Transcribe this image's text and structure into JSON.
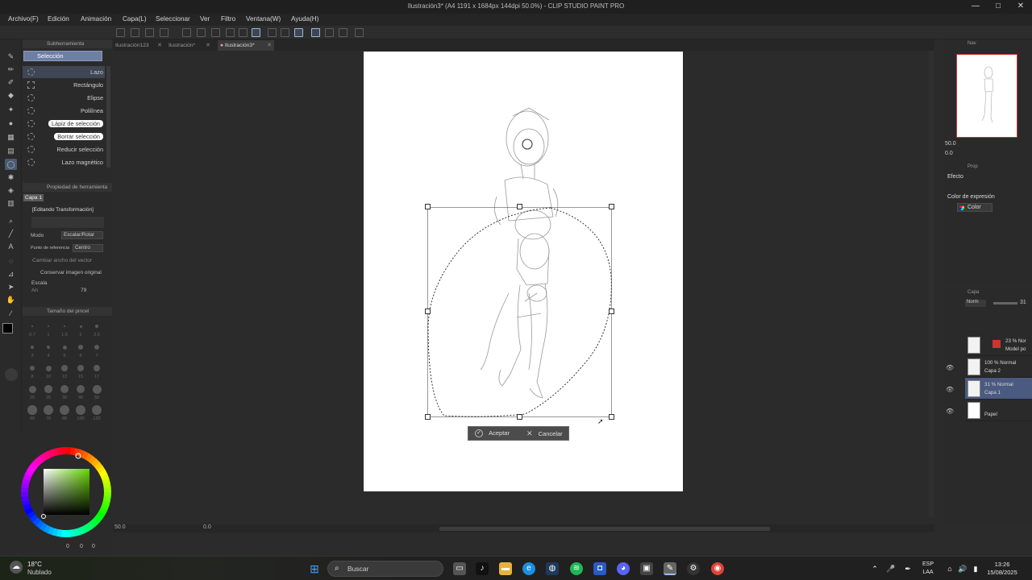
{
  "window": {
    "title": "Ilustración3* (A4 1191 x 1684px 144dpi 50.0%) - CLIP STUDIO PAINT PRO",
    "controls": [
      "—",
      "□",
      "✕"
    ]
  },
  "menu": [
    "Archivo(F)",
    "Edición",
    "Animación",
    "Capa(L)",
    "Seleccionar",
    "Ver",
    "Filtro",
    "Ventana(W)",
    "Ayuda(H)"
  ],
  "subtool": {
    "header": "Subherramienta",
    "active_tab": "Selección",
    "items": [
      "Lazo",
      "Rectángulo",
      "Elipse",
      "Polilínea",
      "Lápiz de selección",
      "Borrar selección",
      "Reducir selección",
      "Lazo magnético"
    ]
  },
  "tool_property": {
    "header": "Propiedad de herramienta",
    "layer_label": "Capa 1",
    "editing_label": "[Editando Transformación]",
    "mode_label": "Modo",
    "mode_value": "Escalar/Rotar",
    "ref_label": "Punto de referencia",
    "ref_value": "Centro",
    "vector_label": "Cambiar ancho del vector",
    "keep_label": "Conservar imagen original",
    "scale_label": "Escala",
    "scale_sub": "An",
    "scale_value": "79"
  },
  "brush_size": {
    "header": "Tamaño del pincel",
    "sizes": [
      "0.7",
      "1",
      "1.5",
      "2",
      "2.5",
      "3",
      "4",
      "5",
      "6",
      "7",
      "8",
      "10",
      "12",
      "15",
      "17",
      "20",
      "25",
      "30",
      "40",
      "50",
      "60",
      "70",
      "80",
      "100",
      "120"
    ]
  },
  "color_panel": {
    "footer": [
      "0",
      "0",
      "0"
    ]
  },
  "documents": {
    "tabs": [
      "Ilustración123",
      "Ilustración*",
      "Ilustración3*"
    ],
    "active": 2
  },
  "transform": {
    "accept": "Aceptar",
    "cancel": "Cancelar"
  },
  "canvas_status": {
    "zoom": "50.0",
    "rotation": "0.0"
  },
  "navigator": {
    "header": "Nav",
    "zoom": "50.0",
    "angle": "0.0"
  },
  "properties": {
    "header": "Prop",
    "effect_label": "Efecto",
    "expression_label": "Color de expresión",
    "expression_value": "Color"
  },
  "layers_panel": {
    "header": "Capa",
    "blend": "Norm",
    "opacity": "31",
    "layers": [
      {
        "line1": "23 % Nor",
        "line2": "Model po",
        "selected": false
      },
      {
        "line1": "100 % Normal",
        "line2": "Capa 2",
        "selected": false
      },
      {
        "line1": "31 % Normal",
        "line2": "Capa 1",
        "selected": true
      },
      {
        "line1": "",
        "line2": "Papel",
        "selected": false
      }
    ]
  },
  "taskbar": {
    "weather_temp": "18°C",
    "weather_desc": "Nublado",
    "search_placeholder": "Buscar",
    "lang_top": "ESP",
    "lang_bottom": "LAA",
    "time": "13:26",
    "date": "15/08/2025"
  },
  "colors": {
    "accent": "#4a5a80",
    "selected_tab": "#6f7fa3",
    "panel_bg": "#2a2a2a",
    "canvas_bg": "#2b2b2b"
  }
}
